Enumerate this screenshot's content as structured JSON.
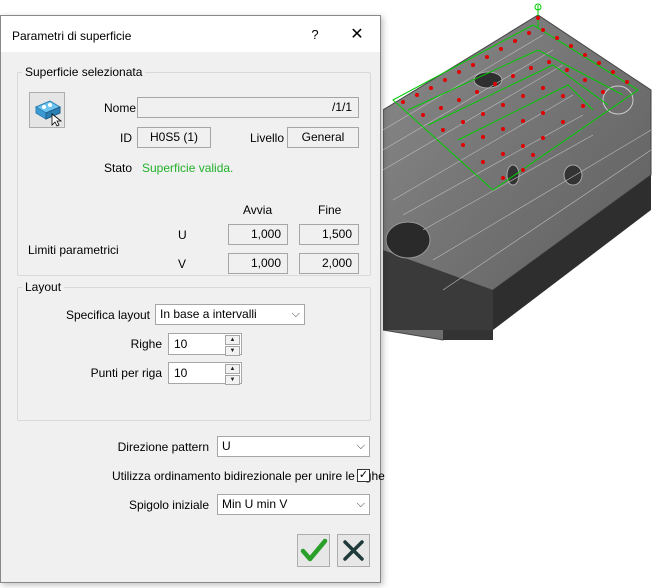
{
  "dialog": {
    "title": "Parametri di superficie",
    "help": "?",
    "close": "✕"
  },
  "surface_group": {
    "legend": "Superficie selezionata",
    "name_label": "Nome",
    "name_value": "/1/1",
    "id_label": "ID",
    "id_value": "H0S5 (1)",
    "level_label": "Livello",
    "level_value": "General",
    "status_label": "Stato",
    "status_value": "Superficie valida.",
    "status_color": "#22b22b",
    "col_start": "Avvia",
    "col_end": "Fine",
    "limits_label": "Limiti parametrici",
    "u_label": "U",
    "v_label": "V",
    "u_start": "1,000",
    "u_end": "1,500",
    "v_start": "1,000",
    "v_end": "2,000"
  },
  "layout_group": {
    "legend": "Layout",
    "spec_label": "Specifica layout",
    "spec_value": "In base a intervalli",
    "rows_label": "Righe",
    "rows_value": "10",
    "points_label": "Punti per riga",
    "points_value": "10"
  },
  "pattern": {
    "direction_label": "Direzione pattern",
    "direction_value": "U",
    "bidir_label": "Utilizza ordinamento bidirezionale per unire le righe",
    "bidir_checked": "✓",
    "corner_label": "Spigolo iniziale",
    "corner_value": "Min U min V"
  },
  "accent": {
    "ok_green": "#2aa02a",
    "cancel_dark": "#1f3a3a",
    "wire_green": "#00cc00",
    "point_red": "#e00000"
  }
}
